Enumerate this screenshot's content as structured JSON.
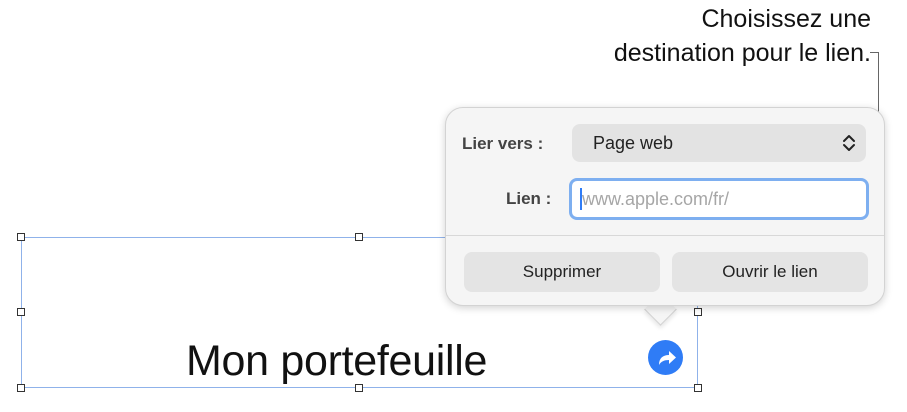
{
  "callout": {
    "line1": "Choisissez une",
    "line2": "destination pour le lien."
  },
  "textbox": {
    "text": "Mon portefeuille"
  },
  "popover": {
    "link_to_label": "Lier vers :",
    "link_to_value": "Page web",
    "link_label": "Lien :",
    "link_placeholder": "www.apple.com/fr/",
    "delete_button": "Supprimer",
    "open_button": "Ouvrir le lien"
  },
  "colors": {
    "accent": "#2f7cf6",
    "focus_ring": "#7eaff0",
    "selection_border": "#8fb2ea"
  },
  "icons": {
    "link_badge": "curved-arrow-icon",
    "select_chevrons": "up-down-chevron-icon"
  }
}
